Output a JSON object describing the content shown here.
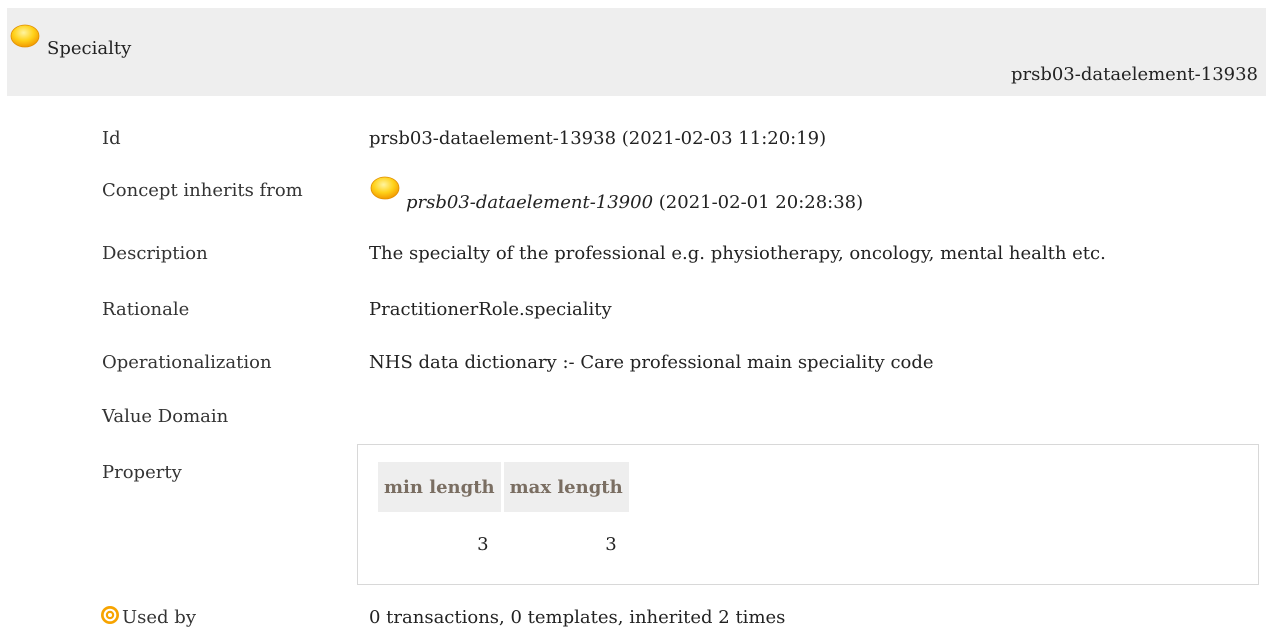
{
  "header": {
    "title": "Specialty",
    "id": "prsb03-dataelement-13938"
  },
  "rows": {
    "id": {
      "label": "Id",
      "value": "prsb03-dataelement-13938 (2021-02-03 11:20:19)"
    },
    "inherits": {
      "label": "Concept inherits from",
      "link": "prsb03-dataelement-13900",
      "date": " (2021-02-01 20:28:38)"
    },
    "description": {
      "label": "Description",
      "value": "The specialty of the professional e.g. physiotherapy, oncology, mental health etc."
    },
    "rationale": {
      "label": "Rationale",
      "value": "PractitionerRole.speciality"
    },
    "operationalization": {
      "label": "Operationalization",
      "value": "NHS data dictionary :- Care professional main speciality code"
    },
    "value_domain": {
      "label": "Value Domain"
    },
    "property": {
      "label": "Property",
      "columns": [
        "min length",
        "max length"
      ],
      "values": [
        "3",
        "3"
      ]
    },
    "used_by": {
      "label": "Used by",
      "value": "0 transactions, 0 templates, inherited 2 times"
    }
  },
  "icons": {
    "concept_icon": "yellow-circle-icon",
    "used_by_icon": "target-icon"
  },
  "colors": {
    "header_bg": "#eeeeee",
    "accent_orange": "#f7a400",
    "th_text": "#7a6e62"
  }
}
